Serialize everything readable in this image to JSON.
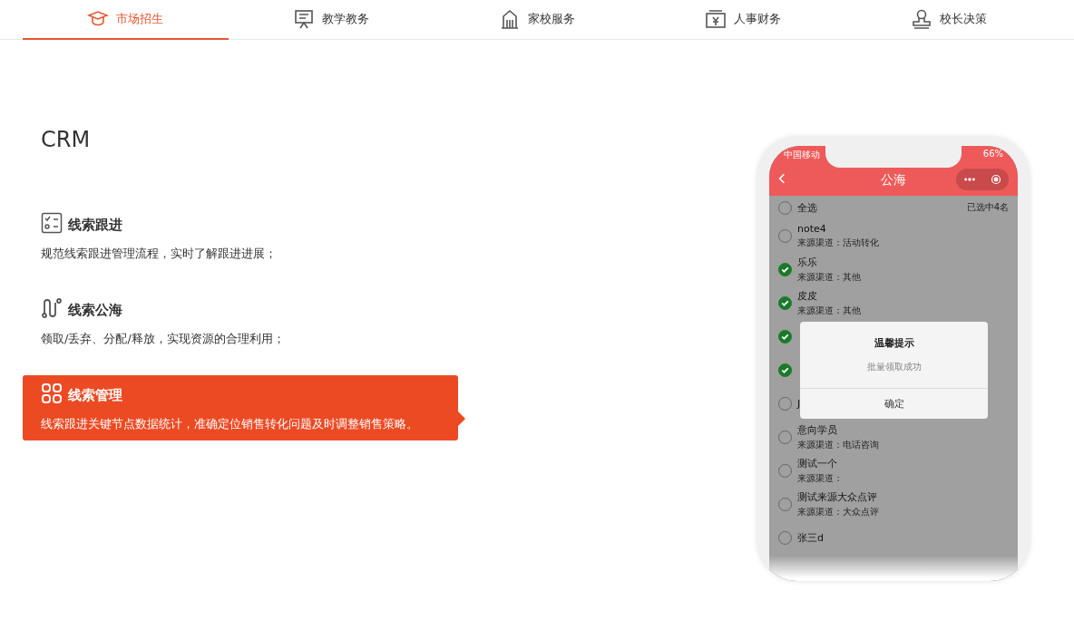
{
  "tabs": [
    {
      "label": "市场招生",
      "selected": true
    },
    {
      "label": "教学教务",
      "selected": false
    },
    {
      "label": "家校服务",
      "selected": false
    },
    {
      "label": "人事财务",
      "selected": false
    },
    {
      "label": "校长决策",
      "selected": false
    }
  ],
  "section_title": "CRM",
  "features": [
    {
      "title": "线索跟进",
      "description": "规范线索跟进管理流程，实时了解跟进进展；",
      "selected": false
    },
    {
      "title": "线索公海",
      "description": "领取/丢弃、分配/释放，实现资源的合理利用；",
      "selected": false
    },
    {
      "title": "线索管理",
      "description": "线索跟进关键节点数据统计，准确定位销售转化问题及时调整销售策略。",
      "selected": true
    }
  ],
  "phone": {
    "carrier": "中国移动",
    "battery": "66%",
    "title": "公海",
    "select_all": "全选",
    "selected_count": "已选中4名",
    "rows": [
      {
        "name": "note4",
        "source": "来源渠道：活动转化",
        "checked": false
      },
      {
        "name": "乐乐",
        "source": "来源渠道：其他",
        "checked": true
      },
      {
        "name": "皮皮",
        "source": "来源渠道：其他",
        "checked": true
      },
      {
        "checked": true
      },
      {
        "checked": true
      },
      {
        "name": "J",
        "checked": false
      },
      {
        "name": "意向学员",
        "source": "来源渠道：电话咨询",
        "checked": false
      },
      {
        "name": "测试一个",
        "source": "来源渠道：",
        "checked": false
      },
      {
        "name": "测试来源大众点评",
        "source": "来源渠道：大众点评",
        "checked": false
      },
      {
        "name": "张三d",
        "checked": false
      }
    ],
    "dialog": {
      "title": "温馨提示",
      "message": "批量领取成功",
      "button": "确定"
    }
  }
}
